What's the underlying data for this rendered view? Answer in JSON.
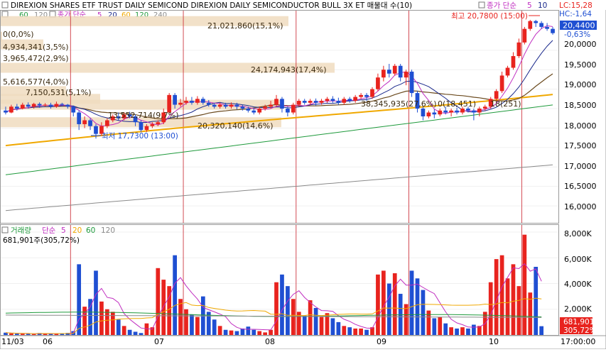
{
  "header": {
    "title": "DIREXION SHARES ETF TRUST DAILY SEMICOND  DIREXION DAILY SEMICONDUCTOR BULL 3X ET 매물대 수(10)",
    "ma_legend": [
      "60",
      "120",
      "240"
    ],
    "price_legend_prefix": "종가 단순",
    "price_legend_periods": [
      "5",
      "20",
      "60",
      "120"
    ],
    "right_legend_prefix": "종가 단순",
    "right_legend_periods": [
      "5",
      "10"
    ],
    "lc": "LC:15,28",
    "hc": "HC:-1,64"
  },
  "price_panel": {
    "current_price": "20,4400",
    "change_pct": "-0,63%",
    "high_label": "최고 20,7800 (15:00)",
    "low_label": "최저 17,7300 (13:00)",
    "y_ticks": [
      "20,0000",
      "19,5000",
      "19,0000",
      "18,5000",
      "18,0000",
      "17,5000",
      "17,0000",
      "16,5000",
      "16,0000"
    ],
    "volume_profile_labels": [
      "0(0,0%)",
      "4,934,341(3,5%)",
      "3,965,472(2,9%)",
      "5,616,577(4,0%)",
      "7,150,531(5,1%)",
      "13,552,714(9,7%)",
      "20,320,140(14,6%)",
      "21,021,860(15,1%)",
      "24,174,943(17,4%)",
      "38,345,935(27,6%)",
      "0(18,451)",
      "18(251)"
    ]
  },
  "volume_panel": {
    "legend_label": "거래량",
    "legend_prefix": "단순",
    "legend_periods": [
      "5",
      "20",
      "60",
      "120"
    ],
    "current_volume": "681,901주(305,72%)",
    "current_volume_box": "681,901",
    "current_pct_box": "305,72%",
    "y_ticks": [
      "8,000K",
      "6,000K",
      "4,000K",
      "2,000K"
    ]
  },
  "x_axis": {
    "labels": [
      "11/03",
      "06",
      "07",
      "08",
      "09",
      "10",
      "17:00:00"
    ]
  },
  "colors": {
    "up": "#e8231e",
    "down": "#1f4fd2",
    "ma5": "#c02ec0",
    "ma20": "#1b2a8c",
    "ma60": "#6b4a1e",
    "ma120": "#f0a800",
    "ma240": "#1f9a3c",
    "ma_long": "#8a8a8a",
    "session_line": "#c8202a",
    "profile_bar": "#f0dcc0"
  },
  "chart_data": {
    "type": "candlestick",
    "title": "DIREXION DAILY SEMICONDUCTOR BULL 3X ET",
    "candles": [
      [
        18.45,
        18.4,
        18.55,
        18.35
      ],
      [
        18.4,
        18.55,
        18.6,
        18.38
      ],
      [
        18.55,
        18.5,
        18.62,
        18.45
      ],
      [
        18.5,
        18.6,
        18.65,
        18.48
      ],
      [
        18.6,
        18.55,
        18.66,
        18.5
      ],
      [
        18.55,
        18.62,
        18.65,
        18.5
      ],
      [
        18.62,
        18.58,
        18.66,
        18.52
      ],
      [
        18.58,
        18.6,
        18.64,
        18.55
      ],
      [
        18.6,
        18.55,
        18.65,
        18.5
      ],
      [
        18.55,
        18.62,
        18.68,
        18.52
      ],
      [
        18.62,
        18.6,
        18.65,
        18.55
      ],
      [
        18.6,
        18.55,
        18.62,
        18.5
      ],
      [
        18.55,
        18.4,
        18.58,
        18.3
      ],
      [
        18.4,
        18.1,
        18.45,
        17.95
      ],
      [
        18.1,
        18.2,
        18.3,
        18.0
      ],
      [
        18.2,
        18.05,
        18.25,
        17.95
      ],
      [
        18.05,
        17.85,
        18.1,
        17.73
      ],
      [
        17.85,
        18.05,
        18.15,
        17.8
      ],
      [
        18.05,
        18.2,
        18.25,
        18.0
      ],
      [
        18.2,
        18.3,
        18.35,
        18.15
      ],
      [
        18.3,
        18.25,
        18.4,
        18.2
      ],
      [
        18.25,
        18.35,
        18.4,
        18.2
      ],
      [
        18.35,
        18.3,
        18.42,
        18.25
      ],
      [
        18.3,
        18.15,
        18.35,
        18.05
      ],
      [
        18.15,
        17.95,
        18.2,
        17.9
      ],
      [
        17.95,
        18.05,
        18.1,
        17.9
      ],
      [
        18.05,
        18.1,
        18.15,
        18.0
      ],
      [
        18.1,
        18.15,
        18.2,
        18.05
      ],
      [
        18.15,
        18.4,
        18.5,
        18.1
      ],
      [
        18.4,
        18.85,
        18.9,
        18.35
      ],
      [
        18.85,
        18.6,
        18.9,
        18.5
      ],
      [
        18.6,
        18.65,
        18.75,
        18.55
      ],
      [
        18.65,
        18.7,
        18.8,
        18.6
      ],
      [
        18.7,
        18.65,
        18.8,
        18.6
      ],
      [
        18.65,
        18.75,
        18.82,
        18.6
      ],
      [
        18.75,
        18.65,
        18.8,
        18.6
      ],
      [
        18.65,
        18.6,
        18.72,
        18.55
      ],
      [
        18.6,
        18.55,
        18.65,
        18.5
      ],
      [
        18.55,
        18.6,
        18.65,
        18.5
      ],
      [
        18.6,
        18.55,
        18.65,
        18.5
      ],
      [
        18.55,
        18.6,
        18.66,
        18.5
      ],
      [
        18.6,
        18.55,
        18.65,
        18.48
      ],
      [
        18.55,
        18.5,
        18.6,
        18.45
      ],
      [
        18.5,
        18.45,
        18.55,
        18.4
      ],
      [
        18.45,
        18.4,
        18.52,
        18.35
      ],
      [
        18.4,
        18.5,
        18.55,
        18.35
      ],
      [
        18.5,
        18.55,
        18.6,
        18.45
      ],
      [
        18.55,
        18.6,
        18.7,
        18.5
      ],
      [
        18.6,
        18.75,
        18.85,
        18.55
      ],
      [
        18.75,
        18.5,
        18.8,
        18.4
      ],
      [
        18.5,
        18.4,
        18.55,
        18.3
      ],
      [
        18.4,
        18.6,
        18.65,
        18.35
      ],
      [
        18.6,
        18.7,
        18.75,
        18.55
      ],
      [
        18.7,
        18.65,
        18.75,
        18.6
      ],
      [
        18.65,
        18.7,
        18.75,
        18.6
      ],
      [
        18.7,
        18.65,
        18.76,
        18.58
      ],
      [
        18.65,
        18.7,
        18.75,
        18.6
      ],
      [
        18.7,
        18.75,
        18.8,
        18.65
      ],
      [
        18.75,
        18.7,
        18.82,
        18.65
      ],
      [
        18.7,
        18.65,
        18.78,
        18.6
      ],
      [
        18.65,
        18.75,
        18.8,
        18.6
      ],
      [
        18.75,
        18.7,
        18.8,
        18.65
      ],
      [
        18.7,
        18.8,
        18.85,
        18.65
      ],
      [
        18.8,
        18.85,
        18.9,
        18.75
      ],
      [
        18.85,
        18.8,
        18.9,
        18.7
      ],
      [
        18.8,
        19.0,
        19.05,
        18.75
      ],
      [
        19.0,
        19.3,
        19.4,
        18.95
      ],
      [
        19.3,
        19.5,
        19.6,
        19.2
      ],
      [
        19.5,
        19.4,
        19.65,
        19.3
      ],
      [
        19.4,
        19.6,
        19.65,
        19.35
      ],
      [
        19.6,
        19.3,
        19.65,
        19.2
      ],
      [
        19.3,
        19.45,
        19.5,
        19.1
      ],
      [
        19.45,
        18.9,
        19.5,
        18.8
      ],
      [
        18.9,
        18.5,
        18.95,
        18.4
      ],
      [
        18.5,
        18.3,
        18.55,
        18.2
      ],
      [
        18.3,
        18.4,
        18.45,
        18.25
      ],
      [
        18.4,
        18.35,
        18.48,
        18.25
      ],
      [
        18.35,
        18.45,
        18.5,
        18.3
      ],
      [
        18.45,
        18.4,
        18.55,
        18.35
      ],
      [
        18.4,
        18.45,
        18.5,
        18.3
      ],
      [
        18.45,
        18.4,
        18.52,
        18.35
      ],
      [
        18.4,
        18.5,
        18.55,
        18.35
      ],
      [
        18.5,
        18.45,
        18.55,
        18.4
      ],
      [
        18.45,
        18.4,
        18.5,
        18.2
      ],
      [
        18.4,
        18.5,
        18.55,
        18.3
      ],
      [
        18.5,
        18.55,
        18.6,
        18.45
      ],
      [
        18.55,
        18.75,
        18.8,
        18.5
      ],
      [
        18.75,
        18.95,
        19.0,
        18.7
      ],
      [
        18.95,
        19.35,
        19.45,
        18.9
      ],
      [
        19.35,
        19.55,
        19.6,
        19.3
      ],
      [
        19.55,
        19.85,
        19.95,
        19.5
      ],
      [
        19.85,
        20.2,
        20.3,
        19.8
      ],
      [
        20.2,
        20.55,
        20.6,
        20.15
      ],
      [
        20.55,
        20.75,
        20.78,
        20.5
      ],
      [
        20.75,
        20.7,
        20.78,
        20.6
      ],
      [
        20.7,
        20.6,
        20.75,
        20.55
      ],
      [
        20.6,
        20.55,
        20.7,
        20.5
      ],
      [
        20.55,
        20.44,
        20.6,
        20.4
      ]
    ],
    "volume_k": [
      180,
      120,
      100,
      90,
      80,
      70,
      150,
      120,
      90,
      80,
      110,
      160,
      300,
      5500,
      2200,
      2800,
      5000,
      2600,
      2000,
      1800,
      1200,
      700,
      400,
      250,
      150,
      900,
      600,
      5200,
      4300,
      3800,
      6200,
      2800,
      2000,
      1600,
      1400,
      3000,
      1800,
      1200,
      700,
      400,
      350,
      300,
      500,
      650,
      400,
      300,
      200,
      400,
      4100,
      4700,
      3800,
      2800,
      1800,
      1500,
      2700,
      2100,
      1400,
      1700,
      1300,
      1000,
      700,
      600,
      500,
      500,
      400,
      600,
      4700,
      5000,
      4000,
      4800,
      3200,
      2400,
      5000,
      4400,
      3500,
      1900,
      1300,
      1400,
      900,
      600,
      500,
      600,
      500,
      800,
      700,
      1800,
      4100,
      5900,
      6200,
      4400,
      5500,
      3800,
      7800,
      3300,
      5300,
      682
    ],
    "ylim": [
      15.6,
      21.0
    ],
    "volume_ylim": [
      0,
      8500
    ]
  }
}
